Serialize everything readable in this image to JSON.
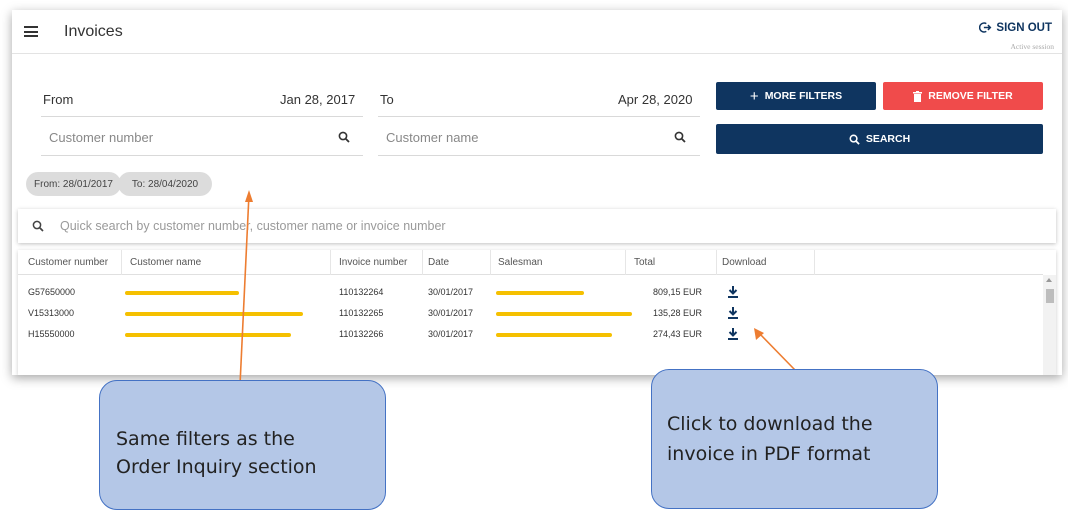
{
  "header": {
    "title": "Invoices",
    "signout_label": "SIGN OUT",
    "session_text": "Active session"
  },
  "filters": {
    "from_label": "From",
    "from_value": "Jan 28, 2017",
    "to_label": "To",
    "to_value": "Apr 28, 2020",
    "customer_number_placeholder": "Customer number",
    "customer_name_placeholder": "Customer name",
    "more_filters_label": "MORE FILTERS",
    "remove_filter_label": "REMOVE FILTER",
    "search_label": "SEARCH"
  },
  "chips": [
    "From: 28/01/2017",
    "To: 28/04/2020"
  ],
  "quick_search": {
    "placeholder": "Quick search by customer number, customer name or invoice number"
  },
  "table": {
    "columns": [
      "Customer number",
      "Customer name",
      "Invoice number",
      "Date",
      "Salesman",
      "Total",
      "Download"
    ],
    "rows": [
      {
        "customer_number": "G57650000",
        "invoice_number": "110132264",
        "date": "30/01/2017",
        "total": "809,15 EUR"
      },
      {
        "customer_number": "V15313000",
        "invoice_number": "110132265",
        "date": "30/01/2017",
        "total": "135,28 EUR"
      },
      {
        "customer_number": "H15550000",
        "invoice_number": "110132266",
        "date": "30/01/2017",
        "total": "274,43 EUR"
      }
    ]
  },
  "annotations": {
    "filters_note_line1": "Same filters as the",
    "filters_note_line2": "Order Inquiry section",
    "download_note_line1": "Click to download the",
    "download_note_line2": "invoice in PDF format"
  },
  "colors": {
    "navy": "#0f3560",
    "red": "#f04b4b",
    "callout_fill": "#b4c7e7",
    "callout_border": "#4472c4",
    "arrow": "#ed7d31",
    "redaction": "#f5c000"
  }
}
